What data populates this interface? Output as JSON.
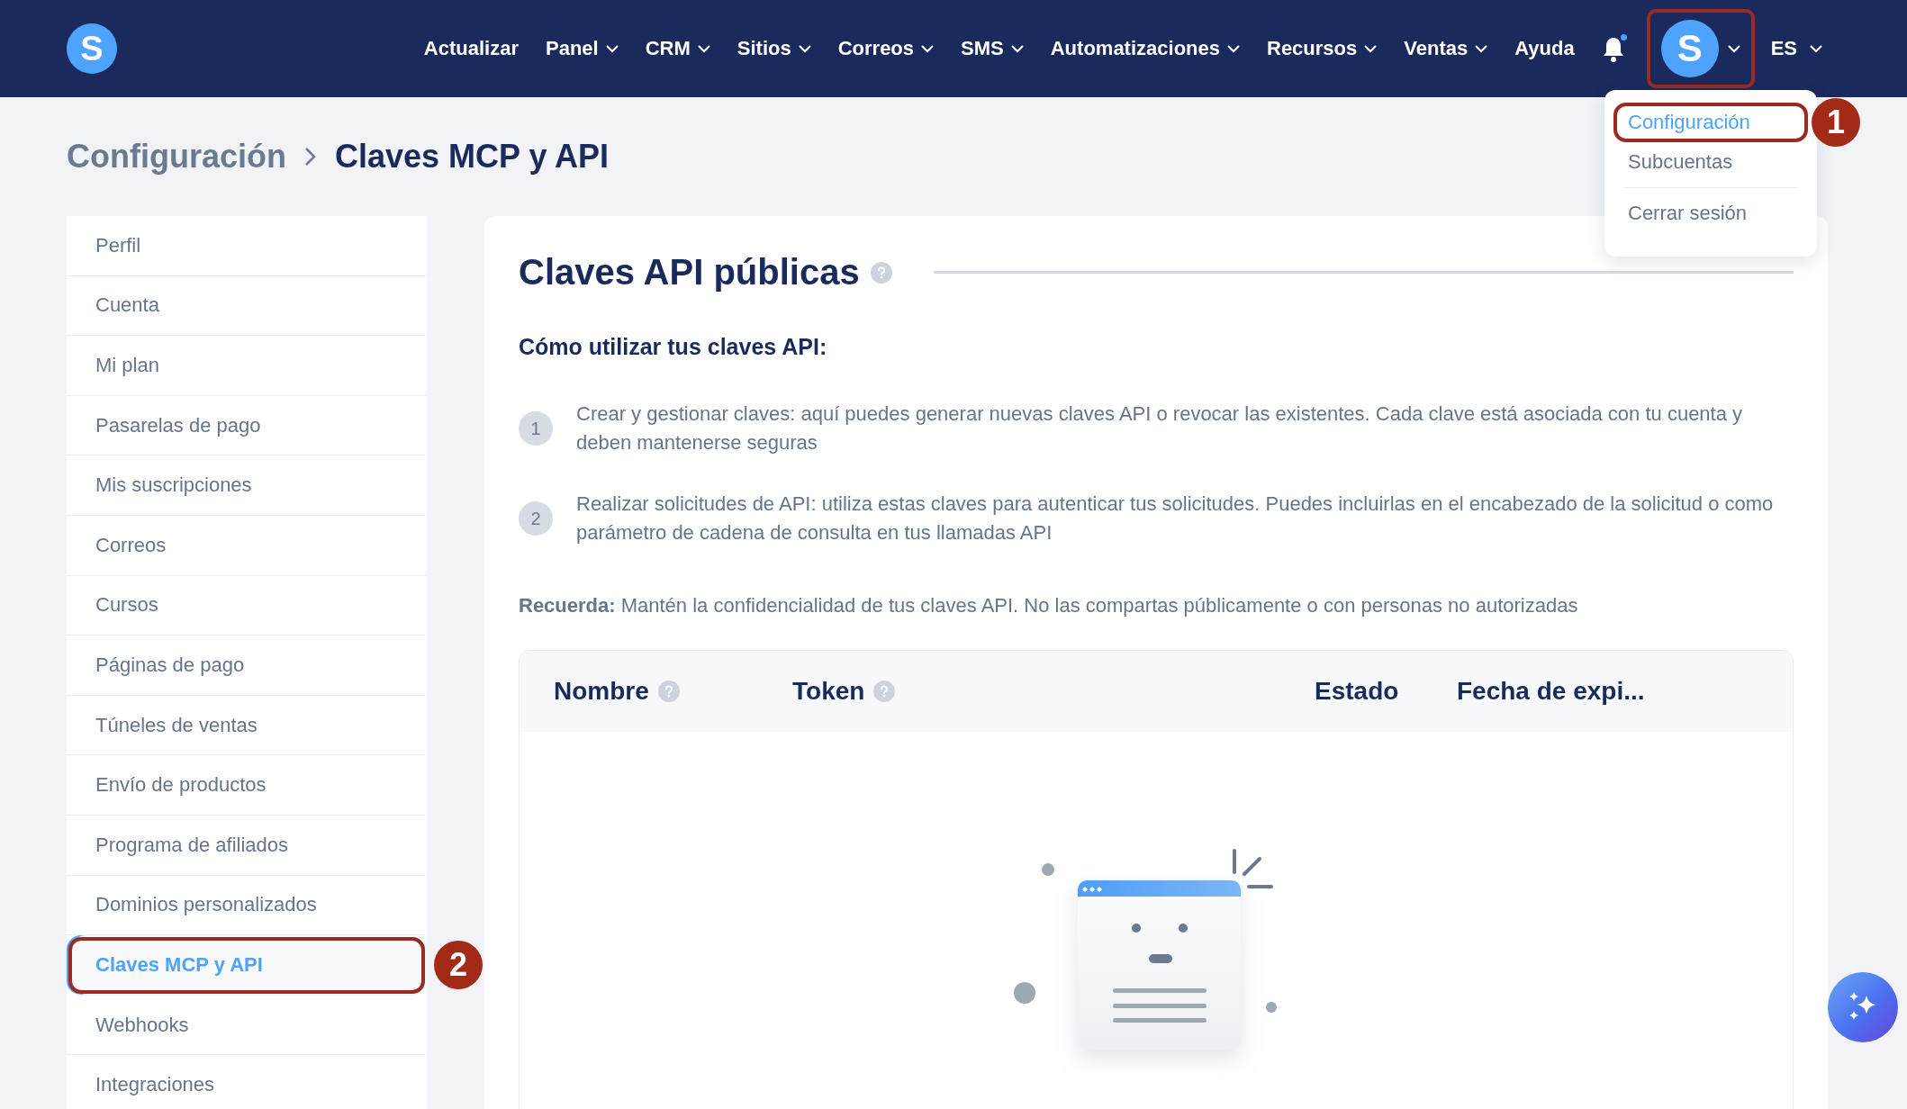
{
  "navbar": {
    "logo": "S",
    "items": [
      {
        "label": "Actualizar",
        "has_menu": false
      },
      {
        "label": "Panel",
        "has_menu": true
      },
      {
        "label": "CRM",
        "has_menu": true
      },
      {
        "label": "Sitios",
        "has_menu": true
      },
      {
        "label": "Correos",
        "has_menu": true
      },
      {
        "label": "SMS",
        "has_menu": true
      },
      {
        "label": "Automatizaciones",
        "has_menu": true
      },
      {
        "label": "Recursos",
        "has_menu": true
      },
      {
        "label": "Ventas",
        "has_menu": true
      },
      {
        "label": "Ayuda",
        "has_menu": false
      }
    ],
    "notifications_unread": true,
    "avatar": {
      "letter": "S",
      "highlighted": true
    },
    "language": "ES"
  },
  "user_menu": {
    "items": [
      {
        "label": "Configuración",
        "selected": true,
        "annotation": "1"
      },
      {
        "label": "Subcuentas",
        "selected": false
      },
      {
        "label": "Cerrar sesión",
        "selected": false
      }
    ]
  },
  "breadcrumb": [
    "Configuración",
    "Claves MCP y API"
  ],
  "sidebar": {
    "items": [
      {
        "label": "Perfil",
        "selected": false
      },
      {
        "label": "Cuenta",
        "selected": false
      },
      {
        "label": "Mi plan",
        "selected": false
      },
      {
        "label": "Pasarelas de pago",
        "selected": false
      },
      {
        "label": "Mis suscripciones",
        "selected": false
      },
      {
        "label": "Correos",
        "selected": false
      },
      {
        "label": "Cursos",
        "selected": false
      },
      {
        "label": "Páginas de pago",
        "selected": false
      },
      {
        "label": "Túneles de ventas",
        "selected": false
      },
      {
        "label": "Envío de productos",
        "selected": false
      },
      {
        "label": "Programa de afiliados",
        "selected": false
      },
      {
        "label": "Dominios personalizados",
        "selected": false
      },
      {
        "label": "Claves MCP y API",
        "selected": true,
        "annotation": "2"
      },
      {
        "label": "Webhooks",
        "selected": false
      },
      {
        "label": "Integraciones",
        "selected": false
      }
    ]
  },
  "content": {
    "title": "Claves API públicas",
    "subtitle": "Cómo utilizar tus claves API:",
    "steps": [
      {
        "number": "1",
        "text": "Crear y gestionar claves: aquí puedes generar nuevas claves API o revocar las existentes. Cada clave está asociada con tu cuenta y deben mantenerse seguras"
      },
      {
        "number": "2",
        "text": "Realizar solicitudes de API: utiliza estas claves para autenticar tus solicitudes. Puedes incluirlas en el encabezado de la solicitud o como parámetro de cadena de consulta en tus llamadas API"
      }
    ],
    "note": "**Recuerda:** Mantén la confidencialidad de tus claves API. No las compartas públicamente o con personas no autorizadas",
    "table": {
      "columns": [
        {
          "label": "Nombre",
          "help": true
        },
        {
          "label": "Token",
          "help": true
        },
        {
          "label": "Estado",
          "help": false
        },
        {
          "label": "Fecha de expi...",
          "help": false
        }
      ]
    }
  }
}
